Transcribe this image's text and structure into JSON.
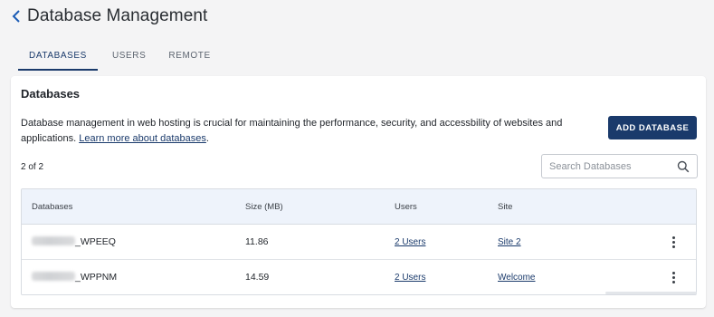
{
  "header": {
    "title": "Database Management",
    "back_icon": "chevron-left-icon"
  },
  "tabs": [
    {
      "label": "DATABASES",
      "active": true
    },
    {
      "label": "USERS",
      "active": false
    },
    {
      "label": "REMOTE",
      "active": false
    }
  ],
  "card": {
    "title": "Databases",
    "description": "Database management in web hosting is crucial for maintaining the performance, security, and accessbility of websites and applications.",
    "learn_more_link": "Learn more about databases",
    "add_button": "ADD DATABASE",
    "count": "2 of 2",
    "search": {
      "placeholder": "Search Databases",
      "value": ""
    }
  },
  "table": {
    "columns": [
      "Databases",
      "Size (MB)",
      "Users",
      "Site"
    ],
    "rows": [
      {
        "database": "_WPEEQ",
        "size": "11.86",
        "users": "2 Users",
        "site": "Site 2"
      },
      {
        "database": "_WPPNM",
        "size": "14.59",
        "users": "2 Users",
        "site": "Welcome"
      }
    ]
  },
  "colors": {
    "accent": "#1a3a6b",
    "table_header_bg": "#eef3fb",
    "page_bg": "#f4f4f5"
  }
}
